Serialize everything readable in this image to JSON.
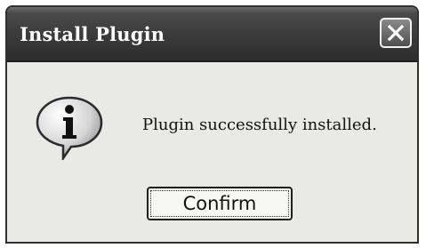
{
  "window": {
    "title": "Install Plugin"
  },
  "icons": {
    "info": "info-icon",
    "close": "close-icon"
  },
  "message": {
    "text": "Plugin successfully installed."
  },
  "buttons": {
    "confirm_label": "Confirm"
  },
  "colors": {
    "titlebar": "#3a3a3a",
    "dialog_background": "#e9e9e6",
    "button_background": "#f7f7f5"
  }
}
